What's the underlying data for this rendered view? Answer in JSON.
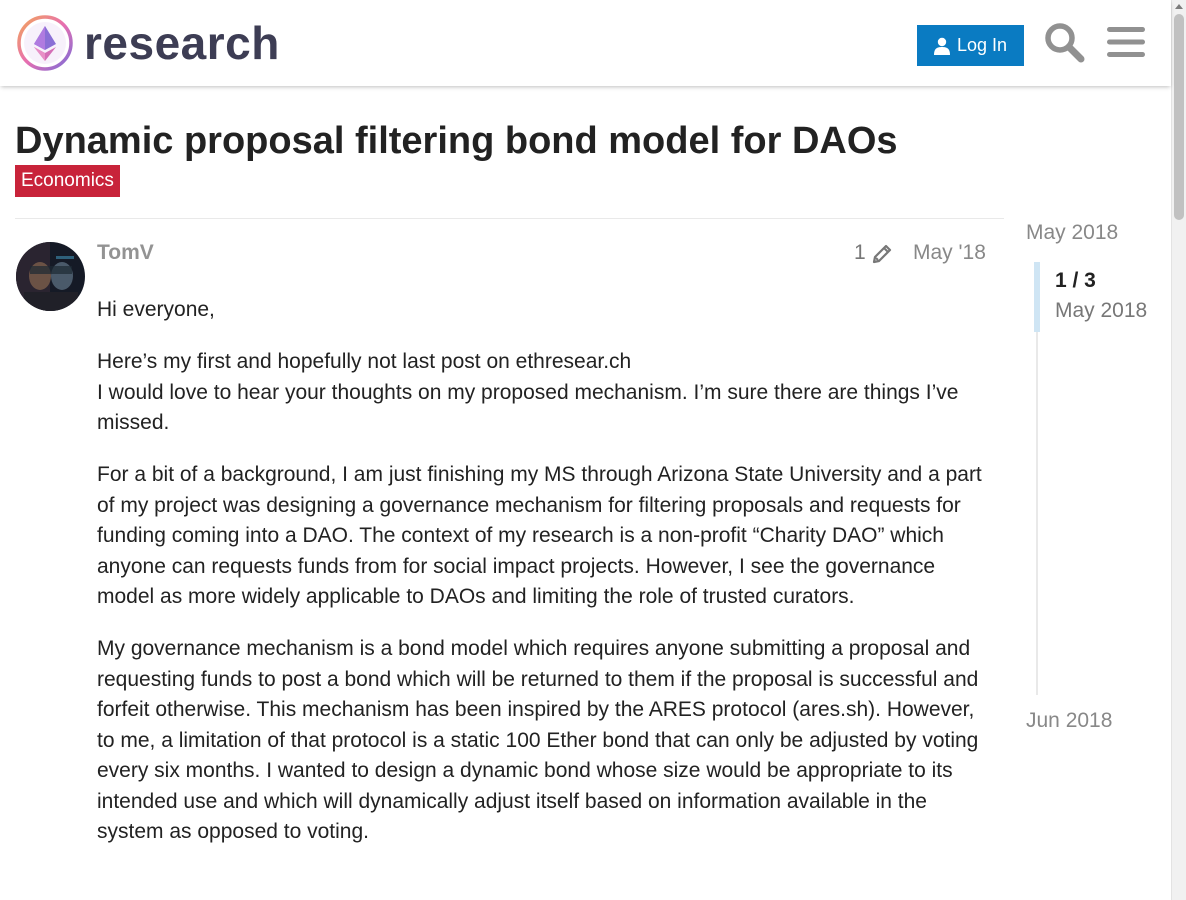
{
  "header": {
    "site_name": "research",
    "login_label": "Log In",
    "search_icon": "search-icon",
    "menu_icon": "hamburger-menu-icon",
    "user_icon": "user-icon",
    "accent_color": "#0a7bc2"
  },
  "topic": {
    "title": "Dynamic proposal filtering bond model for DAOs",
    "category": "Economics",
    "category_color": "#c8233a"
  },
  "post": {
    "username": "TomV",
    "edit_count": "1",
    "edit_icon": "pencil-icon",
    "date": "May '18",
    "paragraphs": [
      "Hi everyone,",
      "Here’s my first and hopefully not last post on ethresear.ch\nI would love to hear your thoughts on my proposed mechanism. I’m sure there are things I’ve missed.",
      "For a bit of a background, I am just finishing my MS through Arizona State University and a part of my project was designing a governance mechanism for filtering proposals and requests for funding coming into a DAO. The context of my research is a non-profit “Charity DAO” which anyone can requests funds from for social impact projects. However, I see the governance model as more widely applicable to DAOs and limiting the role of trusted curators.",
      "My governance mechanism is a bond model which requires anyone submitting a proposal and requesting funds to post a bond which will be returned to them if the proposal is successful and forfeit otherwise. This mechanism has been inspired by the ARES protocol (ares.sh). However, to me, a limitation of that protocol is a static 100 Ether bond that can only be adjusted by voting every six months. I wanted to design a dynamic bond whose size would be appropriate to its intended use and which will dynamically adjust itself based on information available in the system as opposed to voting."
    ]
  },
  "timeline": {
    "start_label": "May 2018",
    "position": "1 / 3",
    "current_date": "May 2018",
    "end_label": "Jun 2018"
  }
}
